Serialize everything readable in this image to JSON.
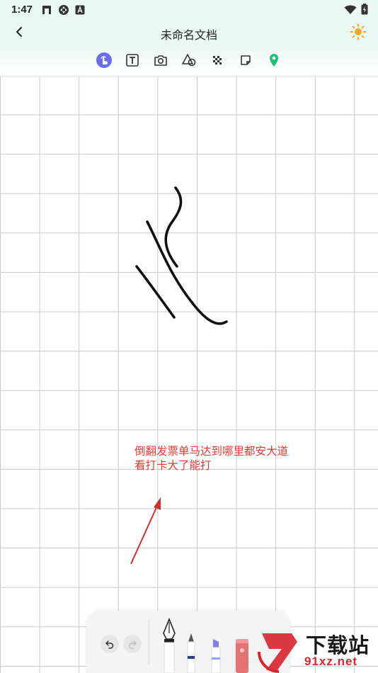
{
  "status_bar": {
    "time": "1:47"
  },
  "header": {
    "title": "未命名文档",
    "back_icon": "chevron-left-icon",
    "theme_icon": "sun-icon"
  },
  "toolbar": {
    "tools": [
      {
        "name": "hand-draw",
        "icon": "touch-hand-icon",
        "active": true
      },
      {
        "name": "text",
        "icon": "text-box-icon",
        "active": false
      },
      {
        "name": "camera",
        "icon": "camera-icon",
        "active": false
      },
      {
        "name": "shapes",
        "icon": "shapes-icon",
        "active": false
      },
      {
        "name": "mosaic",
        "icon": "mosaic-icon",
        "active": false
      },
      {
        "name": "sticky-note",
        "icon": "note-icon",
        "active": false
      },
      {
        "name": "location",
        "icon": "location-pin-icon",
        "active": false
      }
    ],
    "active_color": "#6a6cf0",
    "location_color": "#1fbf7a"
  },
  "canvas": {
    "annotation_text": "倒翻发票单马达到哪里都安大道看打卡大了能打",
    "annotation_color": "#e53935"
  },
  "pen_panel": {
    "undo_icon": "undo-icon",
    "redo_icon": "redo-icon",
    "pens": [
      "fountain-pen",
      "ballpoint-pen",
      "marker-pen",
      "eraser-pen"
    ]
  },
  "watermark": {
    "logo_text": "9",
    "line1": "下载站",
    "line2": "91xz.net"
  }
}
